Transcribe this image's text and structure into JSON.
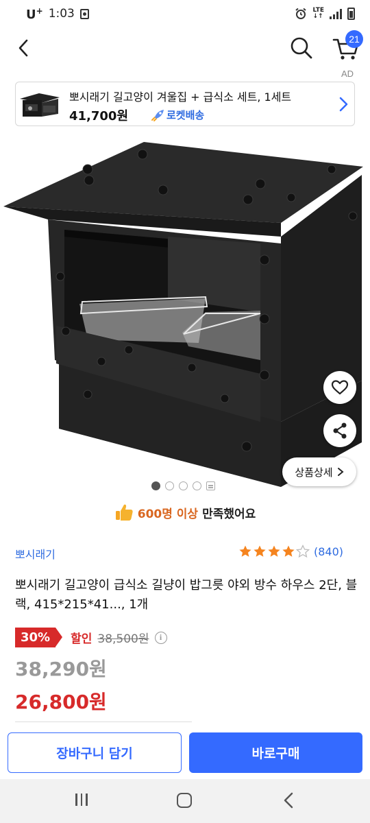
{
  "status_bar": {
    "carrier": "U",
    "carrier_sup": "+",
    "time": "1:03",
    "network": "LTE"
  },
  "header": {
    "cart_count": "21"
  },
  "ad": {
    "label": "AD",
    "title": "뽀시래기 길고양이 겨울집 + 급식소 세트, 1세트",
    "price": "41,700원",
    "delivery_badge": "로켓배송"
  },
  "gallery": {
    "detail_button": "상품상세",
    "total_images": 4,
    "active_index": 0
  },
  "satisfaction": {
    "count_text": "600명 이상",
    "rest_text": "만족했어요"
  },
  "product": {
    "seller": "뽀시래기",
    "rating": 4,
    "rating_max": 5,
    "review_count": "(840)",
    "title": "뽀시래기 길고양이 급식소 길냥이 밥그릇 야외 방수 하우스 2단, 블랙, 415*215*41..., 1개",
    "discount_rate": "30%",
    "discount_label": "할인",
    "original_price": "38,500원",
    "list_price": "38,290원",
    "sale_price": "26,800원"
  },
  "actions": {
    "add_to_cart": "장바구니 담기",
    "buy_now": "바로구매"
  },
  "colors": {
    "accent_blue": "#346aff",
    "sale_red": "#d72a2a",
    "star_orange": "#f5841f"
  }
}
